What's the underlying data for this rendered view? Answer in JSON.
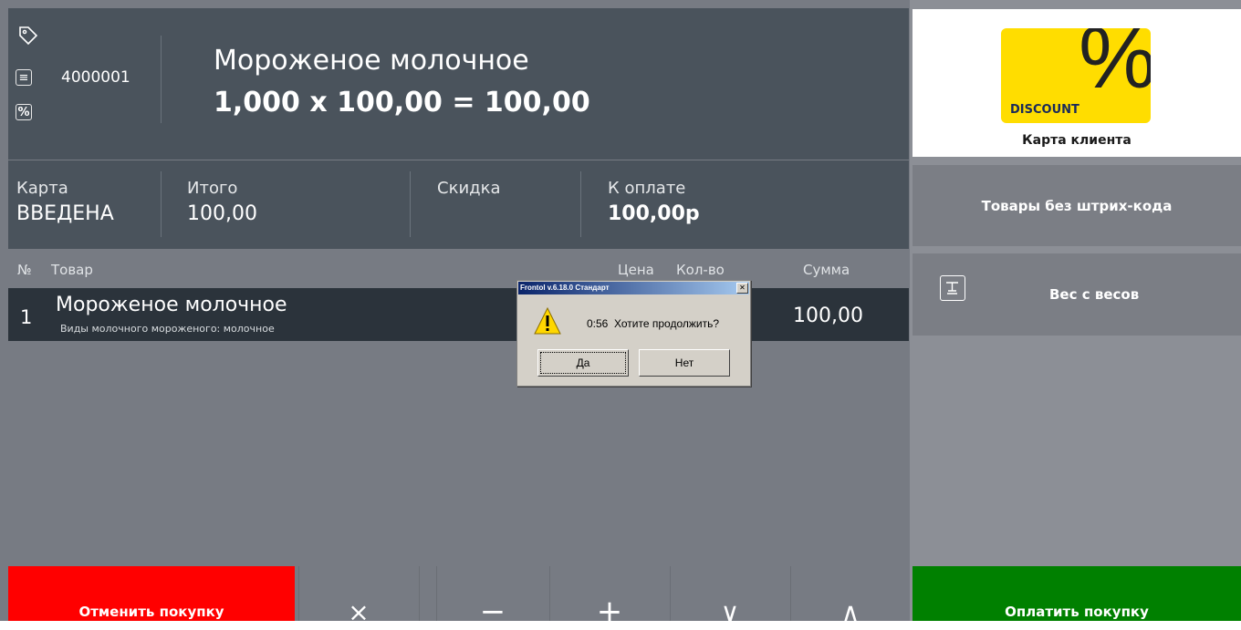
{
  "header": {
    "code": "4000001",
    "product_name": "Мороженое молочное",
    "calc": "1,000 x 100,00 = 100,00"
  },
  "totals": {
    "card_label": "Карта",
    "card_value": "ВВЕДЕНА",
    "total_label": "Итого",
    "total_value": "100,00",
    "discount_label": "Скидка",
    "pay_label": "К оплате",
    "pay_value": "100,00р"
  },
  "table": {
    "headers": {
      "num": "№",
      "item": "Товар",
      "price": "Цена",
      "qty": "Кол-во",
      "sum": "Сумма"
    },
    "rows": [
      {
        "num": "1",
        "name": "Мороженое молочное",
        "sub": "Виды молочного мороженого: молочное",
        "sum": "100,00"
      }
    ]
  },
  "right_panel": {
    "discount_logo": "DISCOUNT",
    "client_card_label": "Карта клиента",
    "no_barcode_label": "Товары без штрих-кода",
    "weight_label": "Вес с весов",
    "pay_button": "Оплатить покупку"
  },
  "bottom": {
    "cancel_button": "Отменить покупку",
    "delete_symbol": "×",
    "minus_symbol": "−",
    "plus_symbol": "+",
    "down_symbol": "∨",
    "up_symbol": "∧"
  },
  "dialog": {
    "title": "Frontol v.6.18.0 Стандарт",
    "message": "0:56  Хотите продолжить?",
    "yes": "Да",
    "no": "Нет"
  },
  "colors": {
    "cancel": "#ff0000",
    "pay": "#008000",
    "discount_card": "#ffdd00"
  }
}
